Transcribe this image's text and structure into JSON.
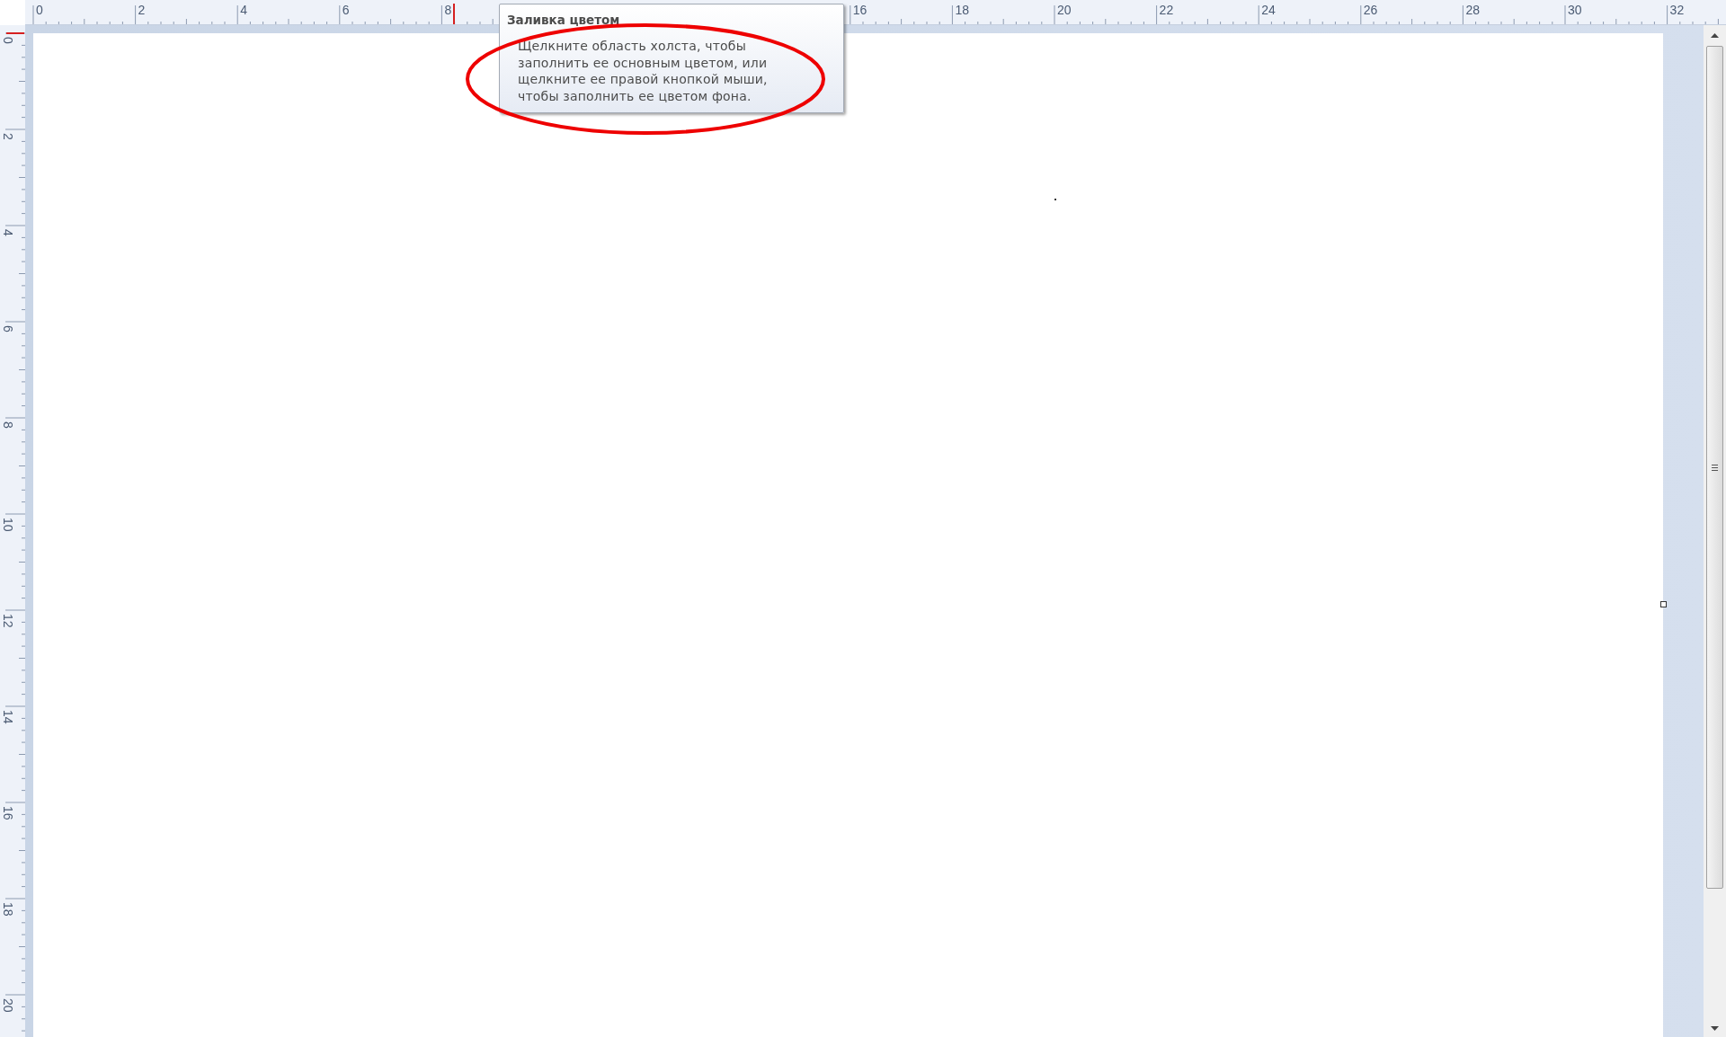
{
  "rulers": {
    "top": {
      "labels": [
        "0",
        "2",
        "4",
        "6",
        "8"
      ],
      "labels_after_tooltip": [
        "16",
        "18",
        "20",
        "22",
        "24",
        "26",
        "28",
        "30",
        "32"
      ]
    },
    "left": {
      "labels": [
        "0",
        "2",
        "4",
        "6",
        "8",
        "10",
        "12",
        "14",
        "16",
        "18",
        "20"
      ]
    }
  },
  "tooltip": {
    "title": "Заливка цветом",
    "text": "Щелкните область холста, чтобы\nзаполнить ее основным цветом, или\nщелкните ее правой кнопкой мыши,\nчтобы заполнить ее цветом фона."
  },
  "annotation": {
    "kind": "ellipse"
  }
}
